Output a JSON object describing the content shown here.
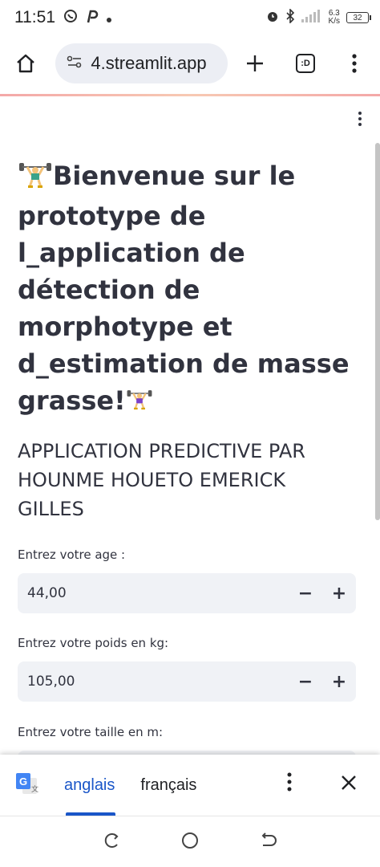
{
  "status_bar": {
    "time": "11:51",
    "network_speed_value": "6.3",
    "network_speed_unit": "K/s",
    "battery": "32"
  },
  "browser": {
    "url": "4.streamlit.app",
    "tab_count_label": ":D"
  },
  "page": {
    "title": "Bienvenue sur le prototype de l_application de détection de morphotype et d_estimation de masse grasse!",
    "subtitle": "APPLICATION PREDICTIVE PAR HOUNME HOUETO EMERICK GILLES",
    "fields": [
      {
        "label": "Entrez votre age :",
        "value": "44,00"
      },
      {
        "label": "Entrez votre poids en kg:",
        "value": "105,00"
      },
      {
        "label": "Entrez votre taille en m:",
        "value": ""
      }
    ],
    "stepper_minus": "−",
    "stepper_plus": "+"
  },
  "translate_bar": {
    "source_lang": "anglais",
    "target_lang": "français"
  },
  "colors": {
    "accent": "#1a56c8",
    "input_bg": "#f0f2f6",
    "text": "#31333f"
  }
}
